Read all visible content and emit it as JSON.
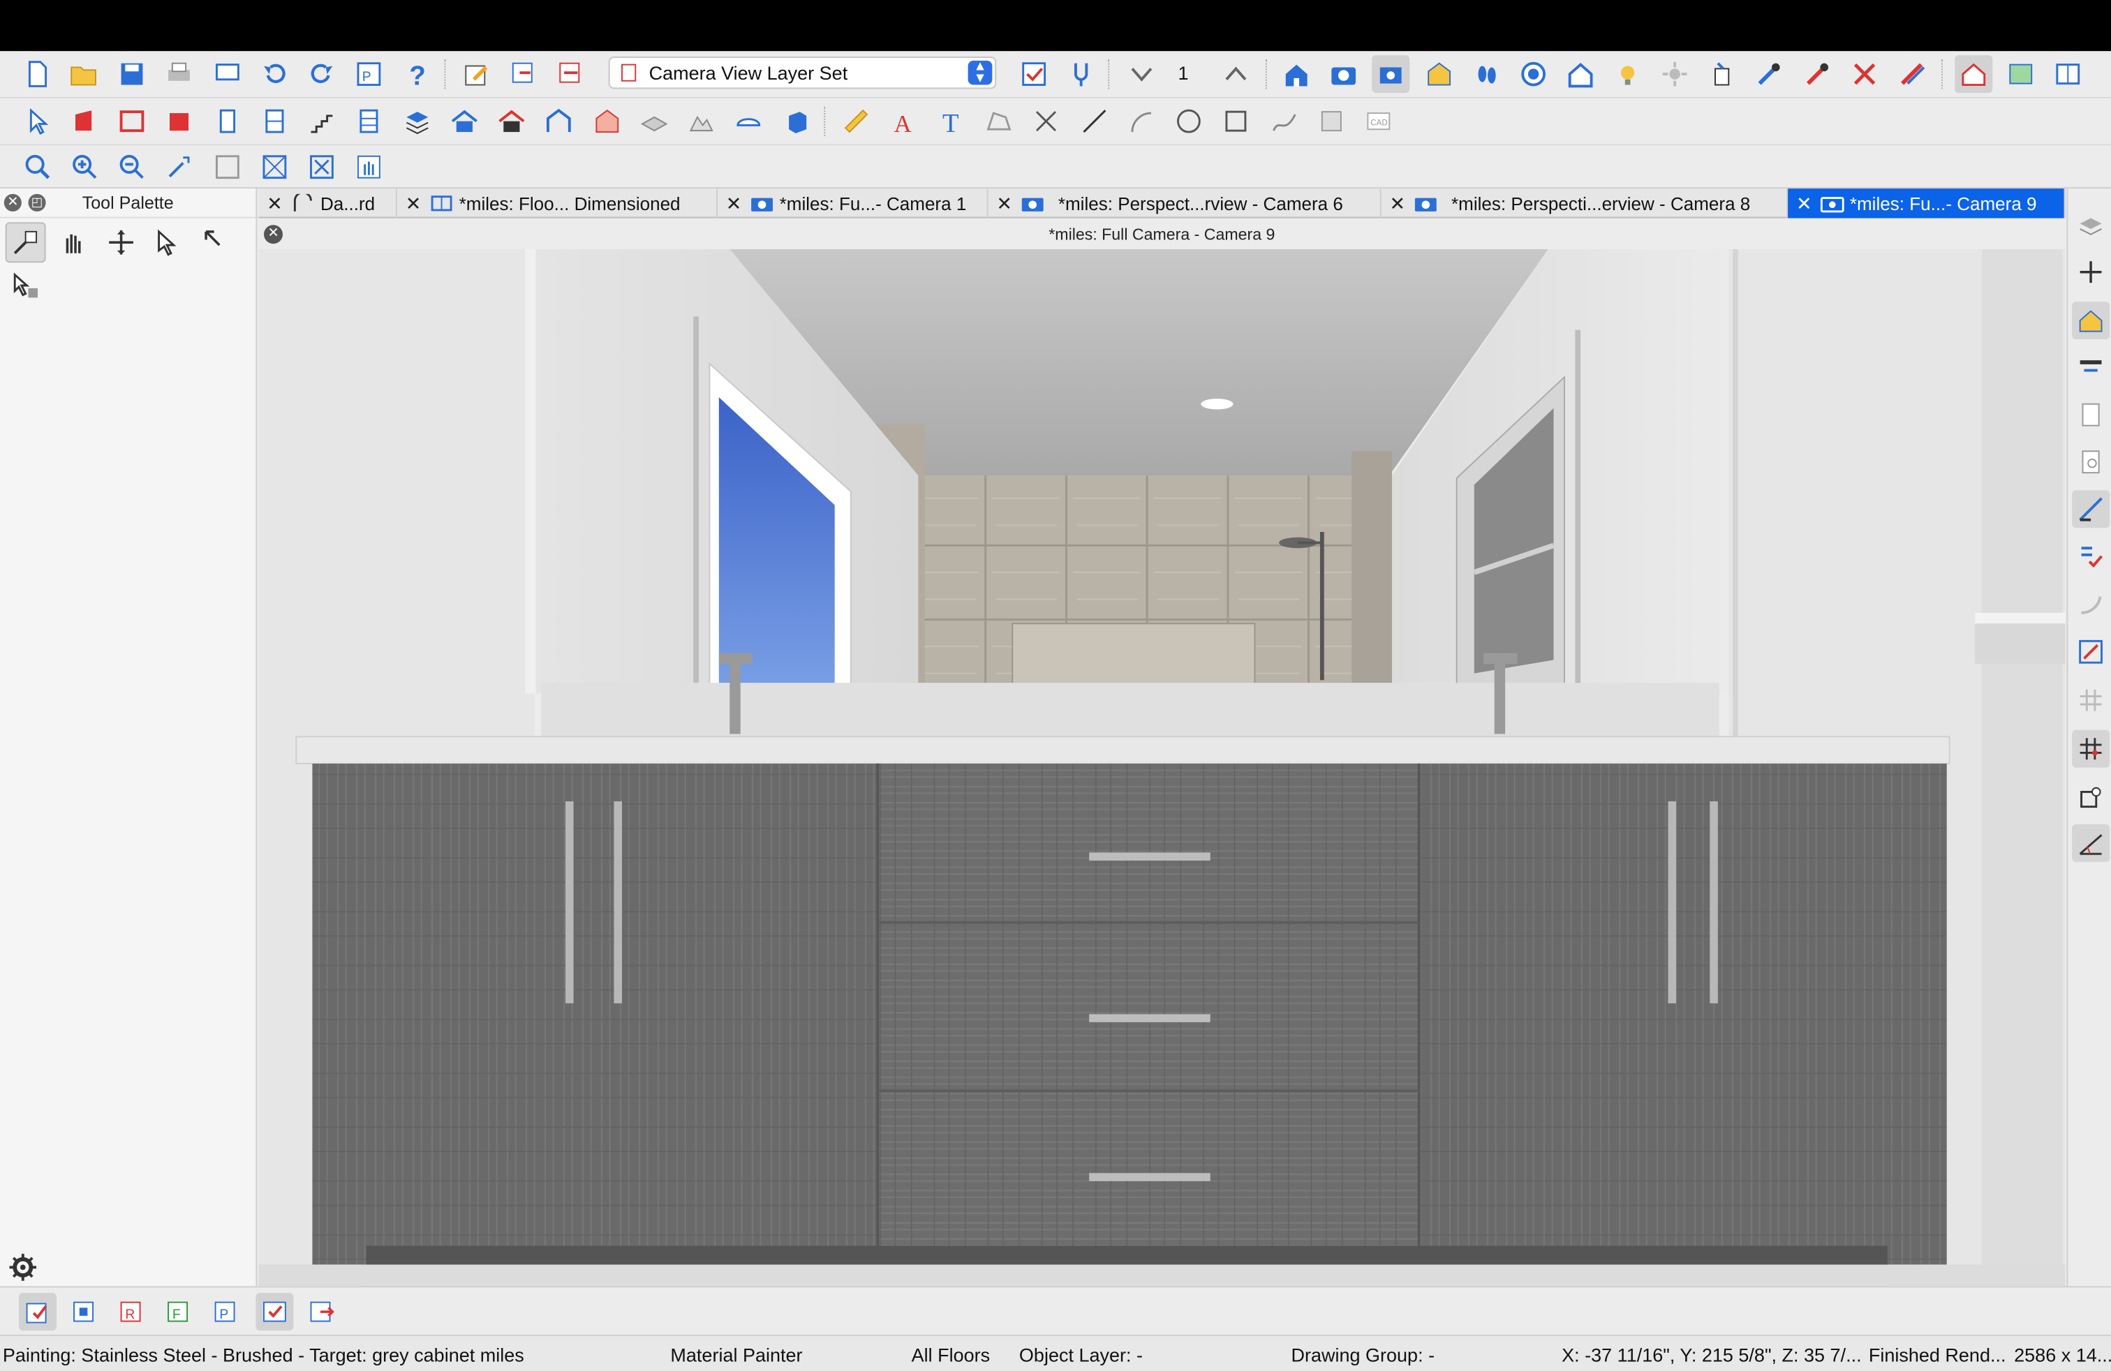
{
  "toolbar_top": {
    "layer_set": "Camera View Layer Set",
    "floor_number": "1"
  },
  "tool_palette": {
    "title": "Tool Palette"
  },
  "tabs": [
    {
      "label": "Da...rd",
      "icon": "arc-icon"
    },
    {
      "label": "*miles: Floo... Dimensioned",
      "icon": "floor-plan-icon"
    },
    {
      "label": "*miles: Fu...- Camera 1",
      "icon": "camera-icon"
    },
    {
      "label": "*miles: Perspect...rview - Camera 6",
      "icon": "camera-icon"
    },
    {
      "label": "*miles: Perspecti...erview - Camera 8",
      "icon": "camera-icon"
    },
    {
      "label": "*miles: Fu...- Camera 9",
      "icon": "camera-icon",
      "active": true
    }
  ],
  "view": {
    "title": "*miles: Full Camera - Camera 9"
  },
  "status": {
    "painting": "Painting: Stainless Steel - Brushed - Target: grey cabinet miles",
    "mode": "Material Painter",
    "floors": "All Floors",
    "object_layer": "Object Layer: -",
    "drawing_group": "Drawing Group: -",
    "coords": "X: -37 11/16\", Y: 215 5/8\", Z: 35 7/...",
    "render": "Finished Rend...",
    "size": "2586 x 14..."
  },
  "colors": {
    "accent": "#0b63e8",
    "topbar": "#000000",
    "cabinet": "#6e6e6e",
    "wall": "#e2e2e2",
    "sky": "#3f6fd0"
  }
}
